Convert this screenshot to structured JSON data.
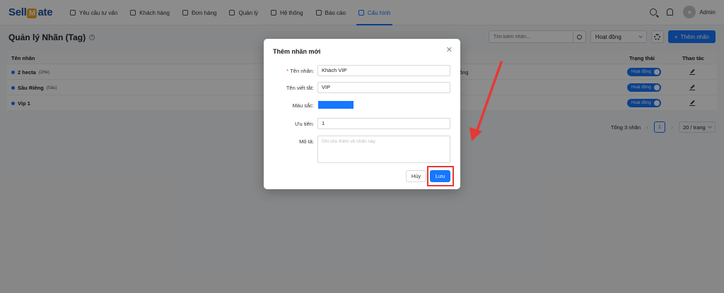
{
  "app": {
    "logo_left": "Sell",
    "logo_mid": "M",
    "logo_right": "ate"
  },
  "nav": [
    {
      "label": "Yêu cầu tư vấn"
    },
    {
      "label": "Khách hàng"
    },
    {
      "label": "Đơn hàng"
    },
    {
      "label": "Quản lý"
    },
    {
      "label": "Hệ thống"
    },
    {
      "label": "Báo cáo"
    },
    {
      "label": "Cấu hình"
    }
  ],
  "user": {
    "name": "Admin"
  },
  "page": {
    "title": "Quản lý Nhãn (Tag)",
    "search_placeholder": "Tìm kiếm nhãn...",
    "status_filter": "Hoạt động",
    "add_button": "Thêm nhãn"
  },
  "table": {
    "headers": {
      "name": "Tên nhãn",
      "status": "Trạng thái",
      "action": "Thao tác"
    },
    "rows": [
      {
        "name": "2 hecta",
        "short": "(2He)",
        "desc": "ông",
        "status": "Hoạt động"
      },
      {
        "name": "Sầu Riêng",
        "short": "(Sầu)",
        "desc": "",
        "status": "Hoạt động"
      },
      {
        "name": "Vip 1",
        "short": "",
        "desc": "",
        "status": "Hoạt động"
      }
    ]
  },
  "pagination": {
    "total": "Tổng 3 nhãn",
    "current": "1",
    "page_size": "20 / trang"
  },
  "modal": {
    "title": "Thêm nhãn mới",
    "fields": {
      "name_label": "Tên nhãn:",
      "name_value": "Khách VIP",
      "short_label": "Tên viết tắt:",
      "short_value": "VIP",
      "color_label": "Màu sắc:",
      "color_value": "#1677ff",
      "priority_label": "Ưu tiên:",
      "priority_value": "1",
      "desc_label": "Mô tả:",
      "desc_placeholder": "Ghi chú thêm về nhãn này"
    },
    "cancel": "Hủy",
    "save": "Lưu"
  },
  "colors": {
    "accent": "#1677ff",
    "annotation": "#e53935"
  }
}
